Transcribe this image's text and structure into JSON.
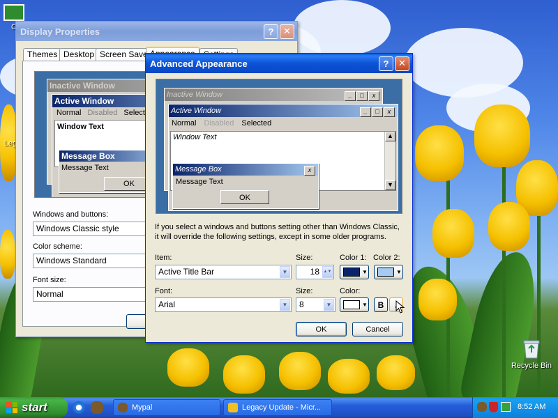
{
  "desktop": {
    "icons": [
      {
        "label": "C",
        "icon": "certificate-icon"
      },
      {
        "label": "Leg",
        "icon": "legacy-icon"
      },
      {
        "label": "Recycle Bin",
        "icon": "recycle-bin-icon"
      }
    ]
  },
  "display_properties": {
    "title": "Display Properties",
    "tabs": [
      "Themes",
      "Desktop",
      "Screen Saver",
      "Appearance",
      "Settings"
    ],
    "selected_tab": "Appearance",
    "preview": {
      "inactive_title": "Inactive Window",
      "active_title": "Active Window",
      "menu_normal": "Normal",
      "menu_disabled": "Disabled",
      "menu_selected": "Selected",
      "window_text": "Window Text",
      "msgbox_title": "Message Box",
      "msgbox_text": "Message Text",
      "ok": "OK"
    },
    "windows_buttons_label": "Windows and buttons:",
    "windows_buttons_value": "Windows Classic style",
    "color_scheme_label": "Color scheme:",
    "color_scheme_value": "Windows Standard",
    "font_size_label": "Font size:",
    "font_size_value": "Normal"
  },
  "advanced_appearance": {
    "title": "Advanced Appearance",
    "preview": {
      "inactive_title": "Inactive Window",
      "active_title": "Active Window",
      "menu_normal": "Normal",
      "menu_disabled": "Disabled",
      "menu_selected": "Selected",
      "window_text": "Window Text",
      "msgbox_title": "Message Box",
      "msgbox_text": "Message Text",
      "ok": "OK"
    },
    "info_line1": "If you select a windows and buttons setting other than Windows Classic,",
    "info_line2": "it will override the following settings, except in some older programs.",
    "item_label": "Item:",
    "item_value": "Active Title Bar",
    "size_label": "Size:",
    "size_value": "18",
    "color1_label": "Color 1:",
    "color2_label": "Color 2:",
    "font_label": "Font:",
    "font_value": "Arial",
    "font_size_label": "Size:",
    "font_size_value": "8",
    "color_label": "Color:",
    "bold_label": "B",
    "italic_label": "I",
    "ok": "OK",
    "cancel": "Cancel",
    "colors": {
      "color1": "#0a246a",
      "color2": "#a6caf0",
      "font_color": "#ffffff"
    }
  },
  "taskbar": {
    "start_label": "start",
    "tasks": [
      "Mypal",
      "Legacy Update - Micr..."
    ],
    "clock": "8:52 AM"
  }
}
